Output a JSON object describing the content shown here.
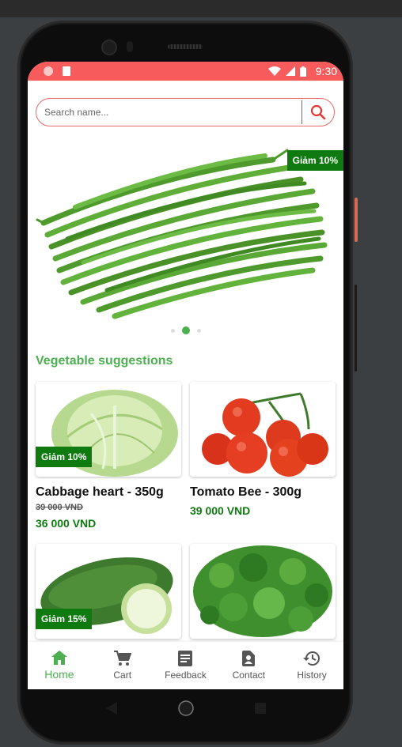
{
  "status": {
    "time": "9:30"
  },
  "search": {
    "placeholder": "Search name..."
  },
  "banner": {
    "badge": "Giảm 10%",
    "active_slide": 2,
    "slide_count": 3
  },
  "section": {
    "title": "Vegetable suggestions"
  },
  "products": [
    {
      "name": "Cabbage heart - 350g",
      "badge": "Giảm 10%",
      "old_price": "39 000 VND",
      "price": "36 000 VND"
    },
    {
      "name": "Tomato Bee - 300g",
      "badge": "",
      "old_price": "",
      "price": "39 000 VND"
    },
    {
      "name": "",
      "badge": "Giảm 15%",
      "old_price": "",
      "price": ""
    },
    {
      "name": "",
      "badge": "",
      "old_price": "",
      "price": ""
    }
  ],
  "nav": {
    "home": "Home",
    "cart": "Cart",
    "feedback": "Feedback",
    "contact": "Contact",
    "history": "History"
  },
  "colors": {
    "status_bar": "#f75b5b",
    "accent_green": "#4caf50",
    "badge_green": "#0f7a0f",
    "search_border": "#e86a6a"
  },
  "icons": [
    "search-icon",
    "home-icon",
    "cart-icon",
    "feedback-icon",
    "contact-icon",
    "history-icon",
    "wifi-icon",
    "signal-icon",
    "battery-icon"
  ]
}
